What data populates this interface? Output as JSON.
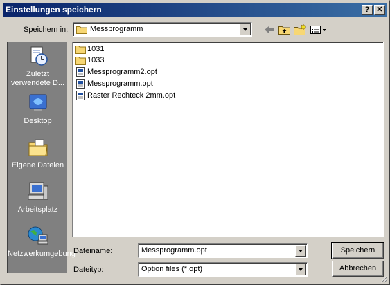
{
  "window": {
    "title": "Einstellungen speichern",
    "help_label": "?",
    "close_label": "✕"
  },
  "toolbar": {
    "save_in_label": "Speichern in:",
    "location": "Messprogramm",
    "icons": [
      "back-arrow-icon",
      "up-folder-icon",
      "new-folder-icon",
      "view-menu-icon"
    ]
  },
  "places": [
    {
      "label": "Zuletzt verwendete D...",
      "icon": "recent-documents-icon"
    },
    {
      "label": "Desktop",
      "icon": "desktop-icon"
    },
    {
      "label": "Eigene Dateien",
      "icon": "my-documents-icon"
    },
    {
      "label": "Arbeitsplatz",
      "icon": "my-computer-icon"
    },
    {
      "label": "Netzwerkumgebung",
      "icon": "network-icon"
    }
  ],
  "files": [
    {
      "name": "1031",
      "type": "folder"
    },
    {
      "name": "1033",
      "type": "folder"
    },
    {
      "name": "Messprogramm2.opt",
      "type": "file"
    },
    {
      "name": "Messprogramm.opt",
      "type": "file"
    },
    {
      "name": "Raster Rechteck 2mm.opt",
      "type": "file"
    }
  ],
  "form": {
    "filename_label": "Dateiname:",
    "filename_value": "Messprogramm.opt",
    "filetype_label": "Dateityp:",
    "filetype_value": "Option files (*.opt)"
  },
  "buttons": {
    "save": "Speichern",
    "cancel": "Abbrechen"
  },
  "colors": {
    "titlebar_start": "#0a246a",
    "titlebar_end": "#3a6ea5",
    "dialog_bg": "#d4d0c8",
    "places_bg": "#808080"
  }
}
